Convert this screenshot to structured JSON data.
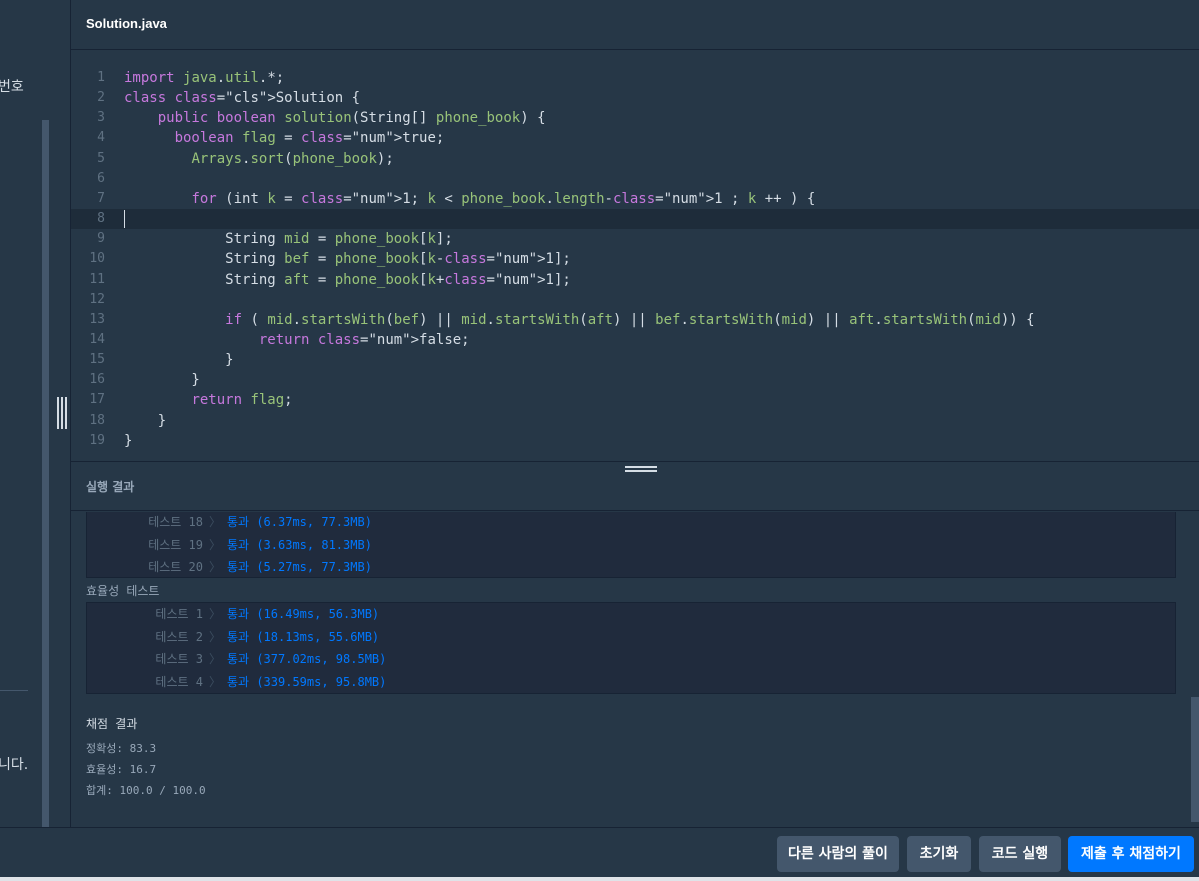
{
  "left_panel": {
    "text_top": "번호",
    "text_bottom": "니다."
  },
  "editor": {
    "file_name": "Solution.java",
    "lines": [
      {
        "n": "1"
      },
      {
        "n": "2"
      },
      {
        "n": "3"
      },
      {
        "n": "4"
      },
      {
        "n": "5"
      },
      {
        "n": "6"
      },
      {
        "n": "7"
      },
      {
        "n": "8"
      },
      {
        "n": "9"
      },
      {
        "n": "10"
      },
      {
        "n": "11"
      },
      {
        "n": "12"
      },
      {
        "n": "13"
      },
      {
        "n": "14"
      },
      {
        "n": "15"
      },
      {
        "n": "16"
      },
      {
        "n": "17"
      },
      {
        "n": "18"
      },
      {
        "n": "19"
      }
    ],
    "code": [
      "import java.util.*;",
      "class Solution {",
      "    public boolean solution(String[] phone_book) {",
      "      boolean flag = true;",
      "        Arrays.sort(phone_book);",
      "",
      "        for (int k = 1; k < phone_book.length-1 ; k ++ ) {",
      "",
      "            String mid = phone_book[k];",
      "            String bef = phone_book[k-1];",
      "            String aft = phone_book[k+1];",
      "",
      "            if ( mid.startsWith(bef) || mid.startsWith(aft) || bef.startsWith(mid) || aft.startsWith(mid)) {",
      "                return false;",
      "            }",
      "        }",
      "        return flag;",
      "    }",
      "}"
    ]
  },
  "results": {
    "title": "실행 결과",
    "accuracy_tests": [
      {
        "label": "테스트 18",
        "result": "통과 (6.37ms, 77.3MB)"
      },
      {
        "label": "테스트 19",
        "result": "통과 (3.63ms, 81.3MB)"
      },
      {
        "label": "테스트 20",
        "result": "통과 (5.27ms, 77.3MB)"
      }
    ],
    "efficiency_label": "효율성  테스트",
    "efficiency_tests": [
      {
        "label": "테스트 1",
        "result": "통과 (16.49ms, 56.3MB)"
      },
      {
        "label": "테스트 2",
        "result": "통과 (18.13ms, 55.6MB)"
      },
      {
        "label": "테스트 3",
        "result": "통과 (377.02ms, 98.5MB)"
      },
      {
        "label": "테스트 4",
        "result": "통과 (339.59ms, 95.8MB)"
      }
    ],
    "score_title": "채점 결과",
    "accuracy_score": "정확성: 83.3",
    "efficiency_score": "효율성: 16.7",
    "total_score": "합계: 100.0 / 100.0"
  },
  "buttons": {
    "others_solution": "다른 사람의 풀이",
    "reset": "초기화",
    "run": "코드 실행",
    "submit": "제출 후 채점하기"
  },
  "colors": {
    "background": "#263747",
    "primary": "#0078ff",
    "button_gray": "#44576c"
  }
}
